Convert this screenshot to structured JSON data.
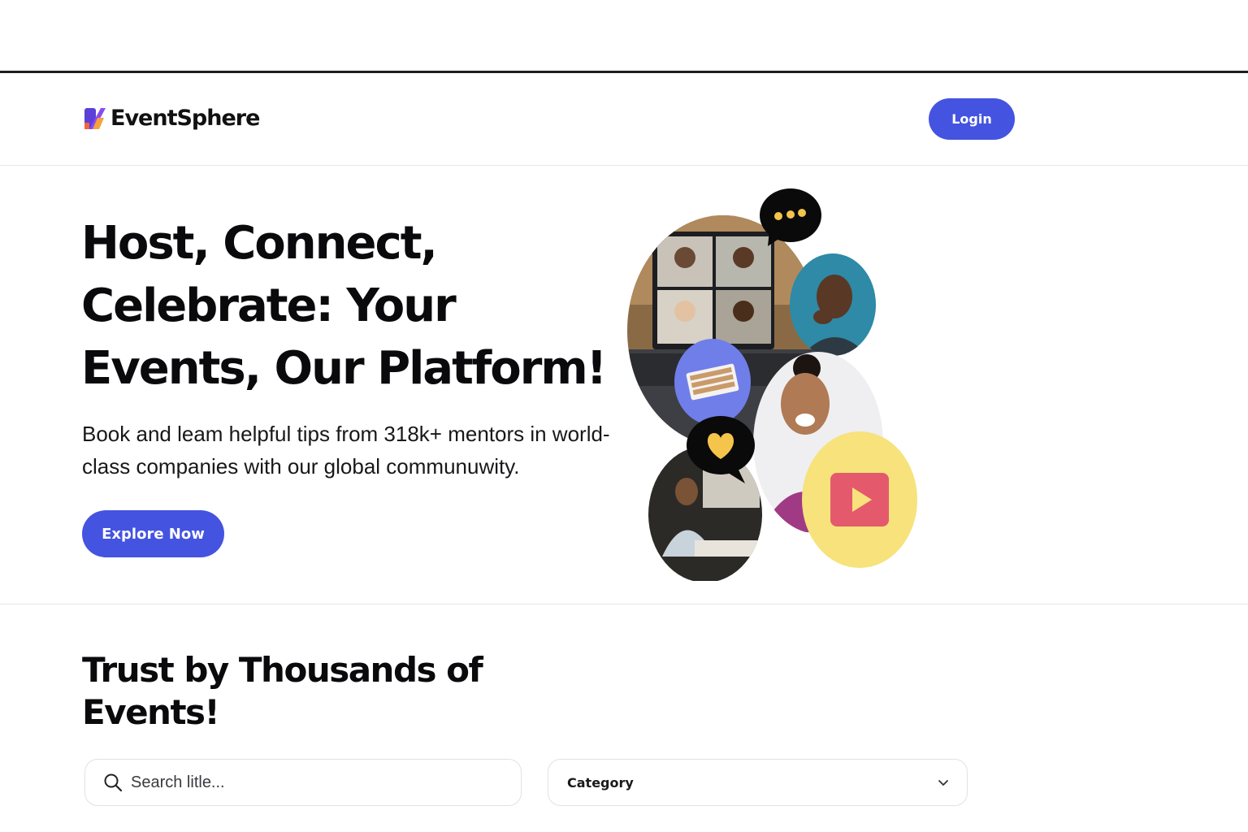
{
  "brand": {
    "name": "EventSphere"
  },
  "nav": {
    "login_label": "Login"
  },
  "hero": {
    "title": "Host, Connect, Celebrate: Your Events, Our Platform!",
    "subtitle": "Book and leam helpful tips from 318k+ mentors in world-class companies with our global communuwity.",
    "cta_label": "Explore Now"
  },
  "trust": {
    "title": "Trust by Thousands of Events!",
    "search_placeholder": "Search litle...",
    "category_label": "Category"
  },
  "colors": {
    "primary": "#4453e0",
    "accent_yellow": "#f7e27c",
    "accent_periwinkle": "#6f7ee9",
    "accent_red": "#e45a6c"
  },
  "icons": [
    "logo-mark-icon",
    "search-icon",
    "chevron-down-icon",
    "chat-dots-icon",
    "heart-icon",
    "play-icon",
    "keyboard-icon"
  ]
}
